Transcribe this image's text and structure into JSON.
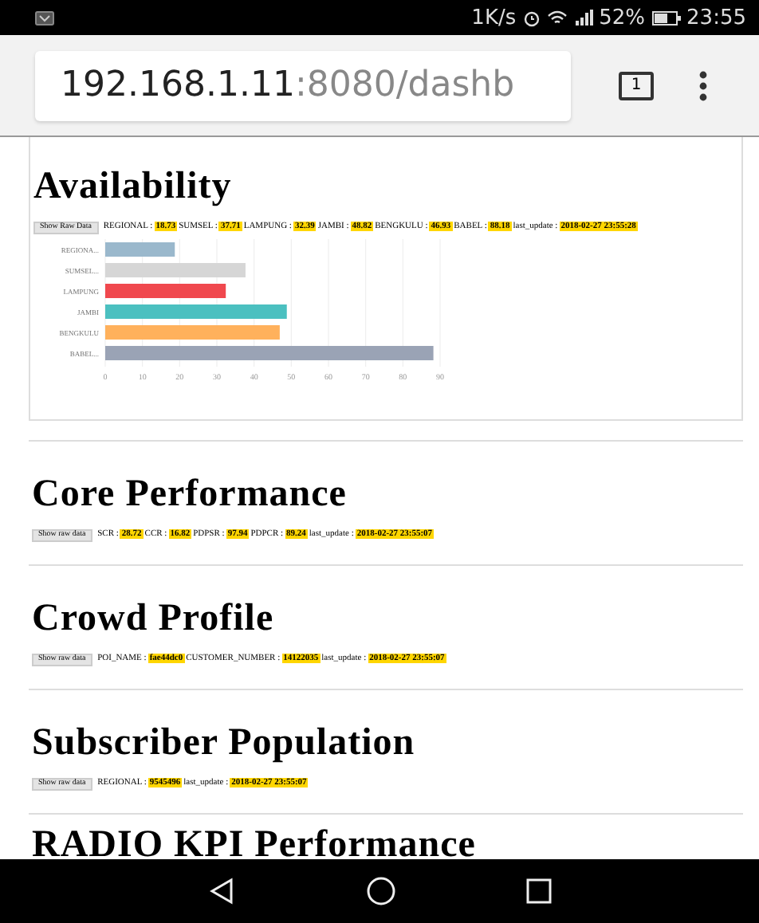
{
  "status_bar": {
    "speed": "1K/s",
    "battery": "52%",
    "time": "23:55"
  },
  "address_bar": {
    "host": "192.168.1.11",
    "path": ":8080/dashb",
    "tab_count": "1"
  },
  "sections": [
    {
      "kind": "chart",
      "title": "Availability",
      "button": "Show Raw Data",
      "metrics": [
        {
          "label": "REGIONAL :",
          "value": "18.73"
        },
        {
          "label": "SUMSEL :",
          "value": "37.71"
        },
        {
          "label": "LAMPUNG :",
          "value": "32.39"
        },
        {
          "label": "JAMBI :",
          "value": "48.82"
        },
        {
          "label": "BENGKULU :",
          "value": "46.93"
        },
        {
          "label": "BABEL :",
          "value": "88.18"
        },
        {
          "label": "last_update :",
          "value": "2018-02-27 23:55:28"
        }
      ],
      "chart_data": {
        "type": "bar",
        "orientation": "horizontal",
        "categories": [
          "REGIONA...",
          "SUMSEL...",
          "LAMPUNG",
          "JAMBI",
          "BENGKULU",
          "BABEL..."
        ],
        "series": [
          {
            "values": [
              18.7,
              37.7,
              32.4,
              48.8,
              46.9,
              88.2
            ]
          }
        ],
        "grid": true,
        "colors": [
          "#9ab8cc",
          "#d6d6d6",
          "#f0484e",
          "#4bc0c0",
          "#ffb15c",
          "#9aa3b5"
        ],
        "xlim": [
          0,
          90
        ],
        "xticks": [
          0,
          10,
          20,
          30,
          40,
          50,
          60,
          70,
          80,
          90
        ]
      }
    },
    {
      "kind": "metrics",
      "title": "Core Performance",
      "button": "Show raw data",
      "metrics": [
        {
          "label": "SCR :",
          "value": "28.72"
        },
        {
          "label": "CCR :",
          "value": "16.82"
        },
        {
          "label": "PDPSR :",
          "value": "97.94"
        },
        {
          "label": "PDPCR :",
          "value": "89.24"
        },
        {
          "label": "last_update :",
          "value": "2018-02-27 23:55:07"
        }
      ]
    },
    {
      "kind": "metrics",
      "title": "Crowd Profile",
      "button": "Show raw data",
      "metrics": [
        {
          "label": "POI_NAME :",
          "value": "fae44dc0"
        },
        {
          "label": "CUSTOMER_NUMBER :",
          "value": "14122035"
        },
        {
          "label": "last_update :",
          "value": "2018-02-27 23:55:07"
        }
      ]
    },
    {
      "kind": "metrics",
      "title": "Subscriber Population",
      "button": "Show raw data",
      "metrics": [
        {
          "label": "REGIONAL :",
          "value": "9545496"
        },
        {
          "label": "last_update :",
          "value": "2018-02-27 23:55:07"
        }
      ]
    },
    {
      "kind": "heading",
      "title": "RADIO KPI Performance"
    }
  ]
}
